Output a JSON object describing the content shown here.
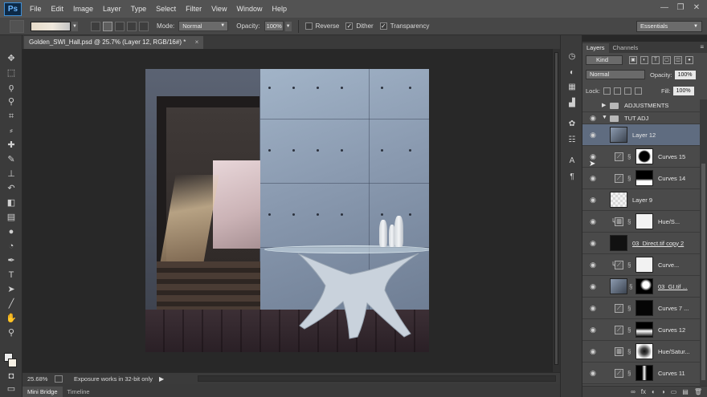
{
  "app": {
    "logo": "Ps"
  },
  "menu": [
    "File",
    "Edit",
    "Image",
    "Layer",
    "Type",
    "Select",
    "Filter",
    "View",
    "Window",
    "Help"
  ],
  "window_controls": [
    "—",
    "❐",
    "✕"
  ],
  "options": {
    "mode_label": "Mode:",
    "mode_value": "Normal",
    "opacity_label": "Opacity:",
    "opacity_value": "100%",
    "reverse_label": "Reverse",
    "dither_label": "Dither",
    "transparency_label": "Transparency",
    "reverse_checked": false,
    "dither_checked": true,
    "transparency_checked": true,
    "workspace": "Essentials"
  },
  "document": {
    "tab_title": "Golden_SWI_Hall.psd @ 25.7% (Layer 12, RGB/16#) *",
    "close": "×"
  },
  "status": {
    "zoom": "25.68%",
    "info": "Exposure works in 32-bit only",
    "play": "▶"
  },
  "bottom_tabs": [
    "Mini Bridge",
    "Timeline"
  ],
  "panel": {
    "tabs": [
      "Layers",
      "Channels"
    ],
    "menu_icon": "≡",
    "kind_label": "Kind",
    "blend_mode": "Normal",
    "opacity_label": "Opacity:",
    "opacity_value": "100%",
    "lock_label": "Lock:",
    "fill_label": "Fill:",
    "fill_value": "100%",
    "footer_icons": [
      "∞",
      "fx",
      "◐",
      "◑",
      "▭",
      "▤",
      "🗑"
    ]
  },
  "layers": [
    {
      "name": "ADJUSTMENTS",
      "type": "group",
      "collapsed": true,
      "visible": false
    },
    {
      "name": "TUT ADJ",
      "type": "group",
      "collapsed": false,
      "visible": true
    },
    {
      "name": "Layer 12",
      "type": "pixel",
      "visible": true,
      "selected": true
    },
    {
      "name": "Curves 15",
      "type": "adjustment",
      "adj_icon": "curves",
      "visible": true,
      "clipped": false
    },
    {
      "name": "Curves 14",
      "type": "adjustment",
      "adj_icon": "curves",
      "visible": true,
      "clipped": false
    },
    {
      "name": "Layer 9",
      "type": "pixel",
      "visible": true
    },
    {
      "name": "Hue/S...",
      "type": "adjustment",
      "adj_icon": "hue-sat",
      "visible": true,
      "clipped": true
    },
    {
      "name": "03_Direct.tif copy 2",
      "type": "pixel",
      "visible": true,
      "underlined": true
    },
    {
      "name": "Curve...",
      "type": "adjustment",
      "adj_icon": "curves",
      "visible": true,
      "clipped": true
    },
    {
      "name": "03_GI.tif ...",
      "type": "pixel",
      "visible": true,
      "underlined": true
    },
    {
      "name": "Curves 7 ...",
      "type": "adjustment",
      "adj_icon": "curves",
      "visible": true,
      "clipped": false
    },
    {
      "name": "Curves 12",
      "type": "adjustment",
      "adj_icon": "curves",
      "visible": true,
      "clipped": false
    },
    {
      "name": "Hue/Satur...",
      "type": "adjustment",
      "adj_icon": "hue-sat",
      "visible": true,
      "clipped": false
    },
    {
      "name": "Curves 11",
      "type": "adjustment",
      "adj_icon": "curves",
      "visible": true,
      "clipped": false
    }
  ],
  "tool_icons": [
    "move-icon",
    "marquee-icon",
    "lasso-icon",
    "quick-select-icon",
    "crop-icon",
    "eyedropper-icon",
    "healing-icon",
    "brush-icon",
    "stamp-icon",
    "history-brush-icon",
    "eraser-icon",
    "gradient-icon",
    "blur-icon",
    "dodge-icon",
    "pen-icon",
    "type-icon",
    "path-select-icon",
    "shape-icon",
    "hand-icon",
    "zoom-icon"
  ],
  "dock_icons": [
    "history-icon",
    "adjust-icon",
    "swatches-icon",
    "histogram-icon",
    "brush-preset-icon",
    "properties-icon",
    "character-icon",
    "paragraph-icon"
  ]
}
